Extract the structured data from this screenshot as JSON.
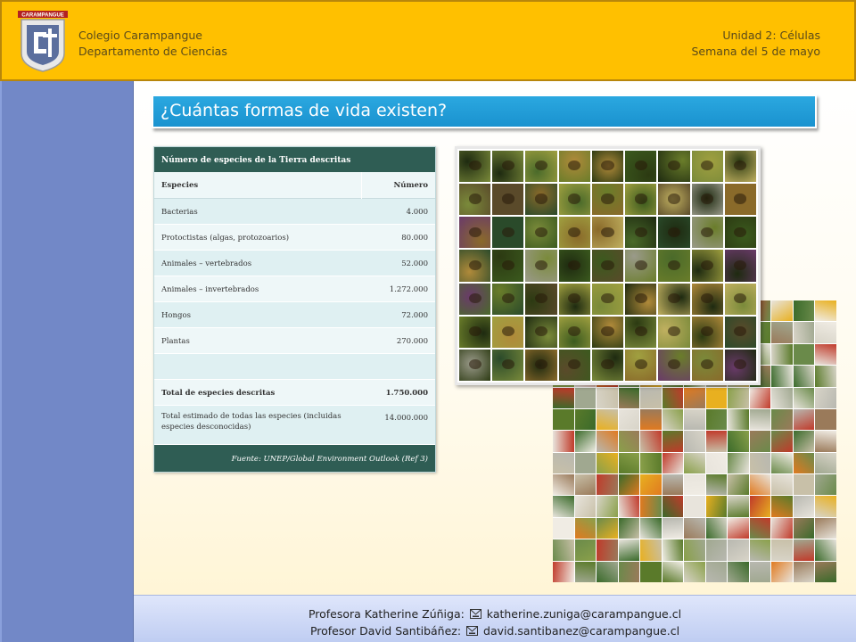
{
  "header": {
    "logo_text": "CARAMPANGUE",
    "school": "Colegio Carampangue",
    "department": "Departamento de Ciencias",
    "unit": "Unidad 2: Células",
    "week": "Semana del 5 de mayo"
  },
  "slide": {
    "title": "¿Cuántas formas de vida existen?"
  },
  "table": {
    "caption": "Número de especies de la Tierra descritas",
    "headers": [
      "Especies",
      "Número"
    ],
    "rows": [
      {
        "name": "Bacterias",
        "value": "4.000"
      },
      {
        "name": "Protoctistas (algas, protozoarios)",
        "value": "80.000"
      },
      {
        "name": "Animales – vertebrados",
        "value": "52.000"
      },
      {
        "name": "Animales – invertebrados",
        "value": "1.272.000"
      },
      {
        "name": "Hongos",
        "value": "72.000"
      },
      {
        "name": "Plantas",
        "value": "270.000"
      }
    ],
    "total": {
      "name": "Total de especies descritas",
      "value": "1.750.000"
    },
    "estimate": {
      "name": "Total estimado de todas las especies (incluidas especies desconocidas)",
      "value": "14.000.000"
    },
    "source": "Fuente: UNEP/Global Environment Outlook  (Ref 3)"
  },
  "images": {
    "insects_icon": "insect-collage",
    "plants_icon": "plant-collage"
  },
  "footer": {
    "line1_prefix": "Profesora Katherine Zúñiga:",
    "line1_email": "katherine.zuniga@carampangue.cl",
    "line2_prefix": "Profesor David Santibáñez:",
    "line2_email": "david.santibanez@carampangue.cl",
    "mail_icon": "envelope-icon"
  },
  "colors": {
    "header_bg": "#ffc000",
    "sidebar_bg": "#7288c7",
    "title_bg": "#1a92cf",
    "table_header_bg": "#2f5d54",
    "footer_bg": "#c8d4f5"
  }
}
